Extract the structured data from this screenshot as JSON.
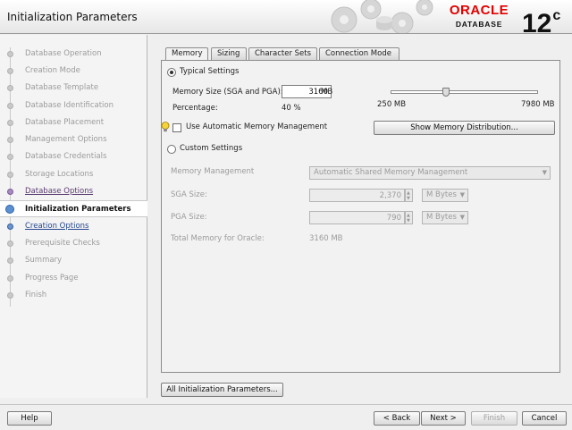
{
  "header": {
    "title": "Initialization Parameters",
    "brand": "ORACLE",
    "brand_sub": "DATABASE",
    "version": "12",
    "version_suffix": "c"
  },
  "steps": [
    {
      "label": "Database Operation",
      "state": "pending"
    },
    {
      "label": "Creation Mode",
      "state": "pending"
    },
    {
      "label": "Database Template",
      "state": "pending"
    },
    {
      "label": "Database Identification",
      "state": "pending"
    },
    {
      "label": "Database Placement",
      "state": "pending"
    },
    {
      "label": "Management Options",
      "state": "pending"
    },
    {
      "label": "Database Credentials",
      "state": "pending"
    },
    {
      "label": "Storage Locations",
      "state": "pending"
    },
    {
      "label": "Database Options",
      "state": "done"
    },
    {
      "label": "Initialization Parameters",
      "state": "current"
    },
    {
      "label": "Creation Options",
      "state": "next"
    },
    {
      "label": "Prerequisite Checks",
      "state": "pending"
    },
    {
      "label": "Summary",
      "state": "pending"
    },
    {
      "label": "Progress Page",
      "state": "pending"
    },
    {
      "label": "Finish",
      "state": "pending"
    }
  ],
  "tabs": [
    {
      "label": "Memory",
      "active": true
    },
    {
      "label": "Sizing",
      "active": false
    },
    {
      "label": "Character Sets",
      "active": false
    },
    {
      "label": "Connection Mode",
      "active": false
    }
  ],
  "memory": {
    "typical_label": "Typical Settings",
    "memory_size_label": "Memory Size (SGA and PGA):",
    "memory_size_value": "3160",
    "memory_size_unit": "MB",
    "percentage_label": "Percentage:",
    "percentage_value": "40 %",
    "slider_min": "250 MB",
    "slider_max": "7980 MB",
    "slider_level": 0.377,
    "amm_label": "Use Automatic Memory Management",
    "show_distribution_label": "Show Memory Distribution...",
    "custom_label": "Custom Settings",
    "mem_mgmt_label": "Memory Management",
    "mem_mgmt_value": "Automatic Shared Memory Management",
    "sga_label": "SGA Size:",
    "sga_value": "2,370",
    "sga_unit": "M Bytes",
    "pga_label": "PGA Size:",
    "pga_value": "790",
    "pga_unit": "M Bytes",
    "total_label": "Total Memory for Oracle:",
    "total_value": "3160 MB"
  },
  "buttons": {
    "all_params": "All Initialization Parameters...",
    "help": "Help",
    "back": "< Back",
    "next": "Next >",
    "finish": "Finish",
    "cancel": "Cancel"
  },
  "colors": {
    "oracle_red": "#e20000",
    "current_step": "#5a8fd0"
  }
}
